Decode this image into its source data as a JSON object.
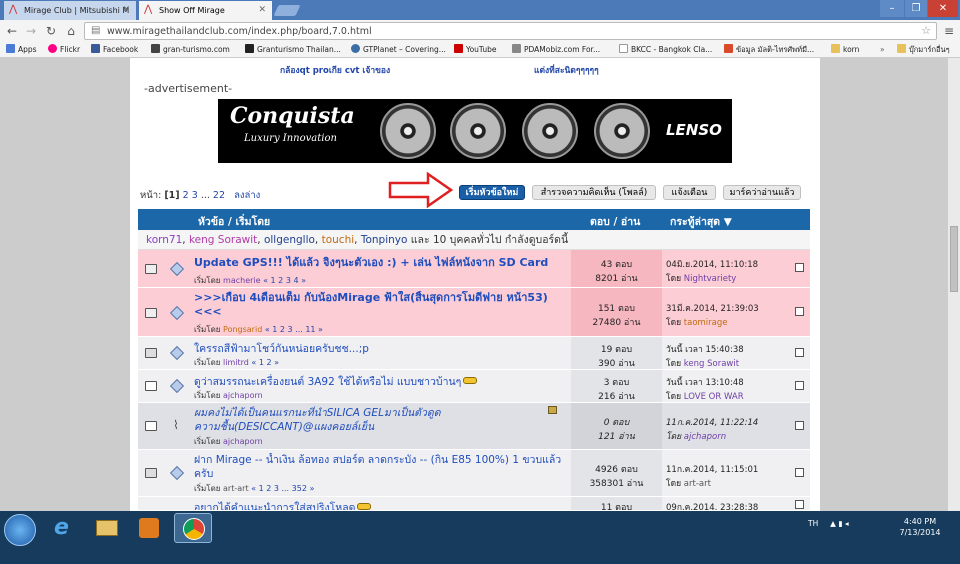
{
  "browser": {
    "tabs": [
      {
        "label": "Mirage Club | Mitsubishi M"
      },
      {
        "label": "Show Off Mirage"
      }
    ],
    "url": "www.miragethailandclub.com/index.php/board,7.0.html",
    "bookmarks": [
      {
        "label": "Apps",
        "color": "#4b7bd6"
      },
      {
        "label": "Flickr",
        "color": "#ff0084"
      },
      {
        "label": "Facebook",
        "color": "#3b5998"
      },
      {
        "label": "gran-turismo.com",
        "color": "#444444"
      },
      {
        "label": "Granturismo Thailan...",
        "color": "#222222"
      },
      {
        "label": "GTPlanet – Covering...",
        "color": "#3a6ea5"
      },
      {
        "label": "YouTube",
        "color": "#cc0000"
      },
      {
        "label": "PDAMobiz.com For...",
        "color": "#888888"
      },
      {
        "label": "BKCC - Bangkok Cla...",
        "color": "#bbbbbb"
      },
      {
        "label": "ข้อมูล มัลติ-ไทรศัพท์มื...",
        "color": "#d94a2b"
      },
      {
        "label": "korn",
        "color": "#e7c15b"
      },
      {
        "label": "บุ๊กมาร์กอื่นๆ",
        "color": "#e7c15b"
      }
    ]
  },
  "forum": {
    "prev_links": [
      "กล้องqt proเกีย cvt เจ้าของ",
      "แต่งที่สะนิดๆๆๆๆๆ"
    ],
    "advert_label": "-advertisement-",
    "banner": {
      "title": "Conquista",
      "subtitle": "Luxury Innovation",
      "brand": "LENSO"
    },
    "pagination": {
      "prefix": "หน้า:",
      "current": "[1]",
      "pages": [
        "2",
        "3",
        "...",
        "22"
      ],
      "down": "ลงล่าง"
    },
    "buttons": [
      "เริ่มหัวข้อใหม่",
      "สำรวจความคิดเห็น (โพลล์)",
      "แจ้งเตือน",
      "มาร์คว่าอ่านแล้ว"
    ],
    "header": {
      "subject": "หัวข้อ / เริ่มโดย",
      "stats": "ตอบ / อ่าน",
      "lastpost": "กระทู้ล่าสุด ▼"
    },
    "online": {
      "users": [
        {
          "name": "korn71",
          "color": "#8a3fc0"
        },
        {
          "name": "keng Sorawit",
          "color": "#b03aa8"
        },
        {
          "name": "ollgengllo",
          "color": "#1f3f8f"
        },
        {
          "name": "touchi",
          "color": "#c46a10"
        },
        {
          "name": "Tonpinyo",
          "color": "#1f3f8f"
        }
      ],
      "suffix": "และ 10 บุคคลทั่วไป กำลังดูบอร์ดนี้"
    },
    "topics": [
      {
        "title": "Update GPS!!! ได้แล้ว จิงๆนะตัวเอง :) + เล่น ไฟล์หนังจาก SD Card",
        "started_by": "เริ่มโดย",
        "author": "macherie",
        "pages": "« 1 2 3 4 »",
        "replies": "43 ตอบ",
        "views": "8201 อ่าน",
        "last_date": "04มิ.ย.2014, 11:10:18",
        "last_by": "โดย",
        "last_user": "Nightvariety"
      },
      {
        "title": ">>>เกือบ 4เดือนเต็ม กับน้องMirage ฟ้าใส(สิ้นสุดการโมดีฟาย หน้า53)<<<",
        "started_by": "เริ่มโดย",
        "author": "Pongsarid",
        "pages": "« 1 2 3 ... 11 »",
        "replies": "151 ตอบ",
        "views": "27480 อ่าน",
        "last_date": "31มี.ค.2014, 21:39:03",
        "last_by": "โดย",
        "last_user": "taomirage"
      },
      {
        "title": "ใครรถสีฟ้ามาโชว์กันหน่อยครับชช...;p",
        "started_by": "เริ่มโดย",
        "author": "limitrd",
        "pages": "« 1 2 »",
        "replies": "19 ตอบ",
        "views": "390 อ่าน",
        "last_date": "วันนี้ เวลา 15:40:38",
        "last_by": "โดย",
        "last_user": "keng Sorawit"
      },
      {
        "title": "ดูว่าสมรรถนะเครื่องยนต์ 3A92 ใช้ได้หรือไม่ แบบชาวบ้านๆ",
        "started_by": "เริ่มโดย",
        "author": "ajchaporn",
        "pages": "",
        "replies": "3 ตอบ",
        "views": "216 อ่าน",
        "last_date": "วันนี้ เวลา 13:10:48",
        "last_by": "โดย",
        "last_user": "LOVE OR WAR"
      },
      {
        "title": "ผมคงไม่ได้เป็นคนแรกนะที่นำSILICA GELมาเป็นตัวดูดความชื้น(DESICCANT)@แผงคอยล์เย็น",
        "started_by": "เริ่มโดย",
        "author": "ajchaporn",
        "pages": "",
        "replies": "0 ตอบ",
        "views": "121 อ่าน",
        "last_date": "11ก.ค.2014, 11:22:14",
        "last_by": "โดย",
        "last_user": "ajchaporn"
      },
      {
        "title": "ฝาก Mirage -- น้ำเงิน ล้อทอง สปอร์ต ลาดกระบัง -- (กิน E85 100%) 1 ขวบแล้วครับ",
        "started_by": "เริ่มโดย",
        "author": "art-art",
        "pages": "« 1 2 3 ... 352 »",
        "replies": "4926 ตอบ",
        "views": "358301 อ่าน",
        "last_date": "11ก.ค.2014, 11:15:01",
        "last_by": "โดย",
        "last_user": "art-art"
      },
      {
        "title": "อยากได้คำแนะนำการใส่สปริงโหลด",
        "started_by": "",
        "author": "",
        "pages": "",
        "replies": "11 ตอบ",
        "views": "",
        "last_date": "09ก.ค.2014, 23:28:38",
        "last_by": "",
        "last_user": ""
      }
    ]
  },
  "taskbar": {
    "lang": "TH",
    "time": "4:40 PM",
    "date": "7/13/2014"
  }
}
